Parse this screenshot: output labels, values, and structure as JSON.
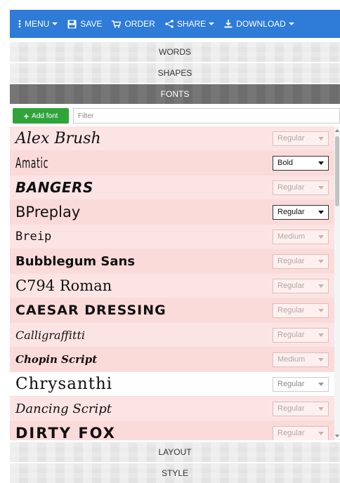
{
  "toolbar": {
    "menu_label": "MENU",
    "save_label": "SAVE",
    "order_label": "ORDER",
    "share_label": "SHARE",
    "download_label": "DOWNLOAD"
  },
  "sections": {
    "words": "WORDS",
    "shapes": "SHAPES",
    "fonts": "FONTS",
    "layout": "LAYOUT",
    "style": "STYLE"
  },
  "fonts_panel": {
    "add_font_label": "Add font",
    "filter_placeholder": "Filter",
    "items": [
      {
        "name": "Alex Brush",
        "weight": "Regular",
        "state": "inactive"
      },
      {
        "name": "Amatic",
        "weight": "Bold",
        "state": "active"
      },
      {
        "name": "BANGERS",
        "weight": "Regular",
        "state": "inactive"
      },
      {
        "name": "BPreplay",
        "weight": "Regular",
        "state": "active"
      },
      {
        "name": "Breip",
        "weight": "Medium",
        "state": "inactive"
      },
      {
        "name": "Bubblegum Sans",
        "weight": "Regular",
        "state": "inactive"
      },
      {
        "name": "C794 Roman",
        "weight": "Regular",
        "state": "inactive"
      },
      {
        "name": "CAESAR DRESSING",
        "weight": "Regular",
        "state": "inactive"
      },
      {
        "name": "Calligraffitti",
        "weight": "Regular",
        "state": "inactive"
      },
      {
        "name": "Chopin Script",
        "weight": "Medium",
        "state": "inactive"
      },
      {
        "name": "Chrysanthi",
        "weight": "Regular",
        "state": "selected"
      },
      {
        "name": "Dancing Script",
        "weight": "Regular",
        "state": "inactive"
      },
      {
        "name": "DIRTY FOX",
        "weight": "Regular",
        "state": "inactive"
      }
    ]
  },
  "colors": {
    "toolbar_bg": "#2e7bd8",
    "add_font_bg": "#2fa43b",
    "active_section_bg": "#6d6d6d",
    "row_bg": "#fde4e4"
  }
}
